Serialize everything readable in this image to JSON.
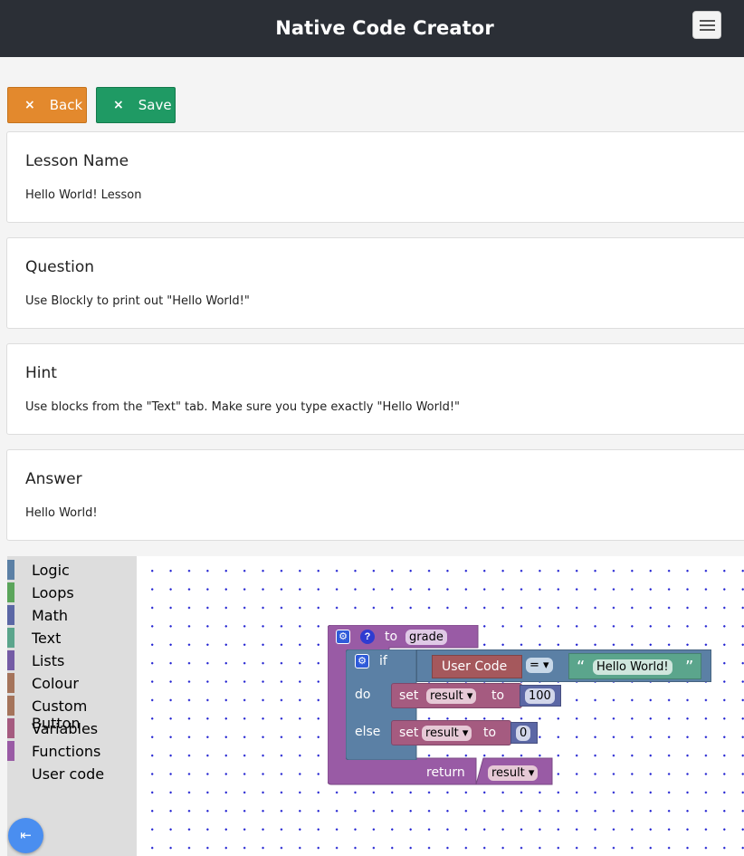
{
  "header": {
    "title": "Native Code Creator",
    "menu_icon": "hamburger-icon"
  },
  "actions": {
    "back": {
      "label": "Back",
      "icon": "×",
      "color": "#e3892d"
    },
    "save": {
      "label": "Save",
      "icon": "×",
      "color": "#1f9a64"
    }
  },
  "cards": [
    {
      "heading": "Lesson Name",
      "text": "Hello World! Lesson"
    },
    {
      "heading": "Question",
      "text": "Use Blockly to print out \"Hello World!\""
    },
    {
      "heading": "Hint",
      "text": "Use blocks from the \"Text\" tab. Make sure you type exactly \"Hello World!\""
    },
    {
      "heading": "Answer",
      "text": "Hello World!"
    }
  ],
  "toolbox": {
    "categories": [
      {
        "label": "Logic",
        "color": "#5b80a5"
      },
      {
        "label": "Loops",
        "color": "#5ba55b"
      },
      {
        "label": "Math",
        "color": "#5b67a5"
      },
      {
        "label": "Text",
        "color": "#5ba58c"
      },
      {
        "label": "Lists",
        "color": "#745ba5"
      },
      {
        "label": "Colour",
        "color": "#a5745b"
      },
      {
        "label": "Custom Button",
        "color": "#a5745b"
      },
      {
        "label": "Variables",
        "color": "#a55b80"
      },
      {
        "label": "Functions",
        "color": "#995ba5"
      },
      {
        "label": "User code",
        "color": ""
      }
    ]
  },
  "blocks": {
    "function": {
      "to_label": "to",
      "name": "grade",
      "return_label": "return",
      "return_var": "result ▾"
    },
    "if_block": {
      "if_label": "if",
      "do_label": "do",
      "else_label": "else"
    },
    "condition": {
      "left": "User Code",
      "operator": "= ▾",
      "open_quote": "“",
      "right": "Hello World!",
      "close_quote": "”"
    },
    "set_do": {
      "set_label": "set",
      "var": "result ▾",
      "to_label": "to",
      "value": "100"
    },
    "set_else": {
      "set_label": "set",
      "var": "result ▾",
      "to_label": "to",
      "value": "0"
    },
    "colors": {
      "procedure": "#995ba5",
      "logic": "#5b80a5",
      "variable": "#a55b80",
      "math": "#5b67a5",
      "text": "#5ba58c",
      "usercode": "#a5585c"
    }
  },
  "fab": {
    "icon": "collapse-menu-icon",
    "glyph": "⇤"
  }
}
